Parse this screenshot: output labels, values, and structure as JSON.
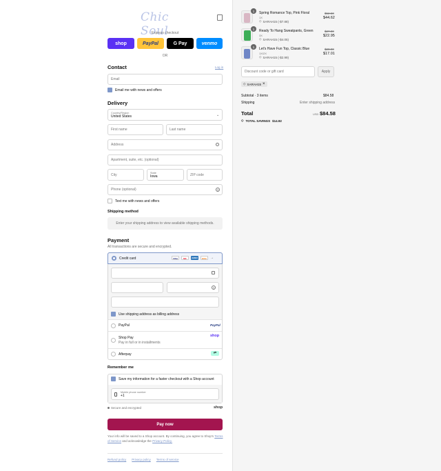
{
  "header": {
    "logo_text": "Chic Soul",
    "express_checkout": "Express checkout",
    "or": "OR"
  },
  "express": {
    "shop": "shop",
    "paypal": "PayPal",
    "gpay": "G Pay",
    "venmo": "venmo"
  },
  "contact": {
    "title": "Contact",
    "login": "Log in",
    "email_placeholder": "Email",
    "news_label": "Email me with news and offers"
  },
  "delivery": {
    "title": "Delivery",
    "country_label": "Country/Region",
    "country_value": "United States",
    "first_name": "First name",
    "last_name": "Last name",
    "address": "Address",
    "apartment": "Apartment, suite, etc. (optional)",
    "city": "City",
    "state_label": "State",
    "state_value": "Iowa",
    "zip": "ZIP code",
    "phone": "Phone (optional)",
    "text_label": "Text me with news and offers"
  },
  "shipping": {
    "title": "Shipping method",
    "message": "Enter your shipping address to view available shipping methods."
  },
  "payment": {
    "title": "Payment",
    "subtitle": "All transactions are secure and encrypted.",
    "credit_card": "Credit card",
    "card_brands": [
      "VISA",
      "MC",
      "AMEX",
      "DISC"
    ],
    "billing_label": "Use shipping address as billing address",
    "paypal": "PayPal",
    "paypal_logo": "PayPal",
    "shop_pay": "Shop Pay",
    "shop_pay_sub": "Pay in full or in installments",
    "shop_logo": "shop",
    "afterpay": "Afterpay"
  },
  "remember": {
    "title": "Remember me",
    "save_label": "Save my information for a faster checkout with a Shop account",
    "mobile_label": "Mobile phone number",
    "mobile_value": "+1",
    "secure": "Secure and encrypted",
    "shop_logo": "shop"
  },
  "pay_now": "Pay now",
  "disclaimer": {
    "text1": "Your info will be saved to a Shop account. By continuing, you agree to Shop's",
    "terms": "Terms of Service",
    "text2": "and acknowledge the",
    "privacy": "Privacy Policy."
  },
  "footer": {
    "refund": "Refund policy",
    "privacy": "Privacy policy",
    "terms": "Terms of service"
  },
  "order": {
    "items": [
      {
        "qty": "1",
        "name": "Spring Romance Top, Pink Floral",
        "variant": "1X",
        "discount": "SARAH15 (-$7.88)",
        "old_price": "$52.50",
        "price": "$44.62",
        "color": "#d9b7c4"
      },
      {
        "qty": "1",
        "name": "Ready To Hang Sweatpants, Green",
        "variant": "3X",
        "discount": "SARAH15 (-$4.05)",
        "old_price": "$27.00",
        "price": "$22.95",
        "color": "#3cae57"
      },
      {
        "qty": "1",
        "name": "Let's Have Fun Top, Classic Blue",
        "variant": "1X/2X",
        "discount": "SARAH15 (-$2.99)",
        "old_price": "$20.00",
        "price": "$17.01",
        "color": "#6f86c6"
      }
    ],
    "discount_placeholder": "Discount code or gift card",
    "apply": "Apply",
    "code_tag": "SARAH15",
    "subtotal_label": "Subtotal · 3 items",
    "subtotal_value": "$84.58",
    "shipping_label": "Shipping",
    "shipping_value": "Enter shipping address",
    "total_label": "Total",
    "currency": "USD",
    "total_value": "$84.58",
    "savings_label": "TOTAL SAVINGS",
    "savings_value": "$14.92"
  },
  "colors": {
    "accent": "#7e97c9",
    "pay_button": "#a3154f",
    "shop": "#5a31f4",
    "paypal": "#ffc439",
    "venmo": "#008cff"
  }
}
